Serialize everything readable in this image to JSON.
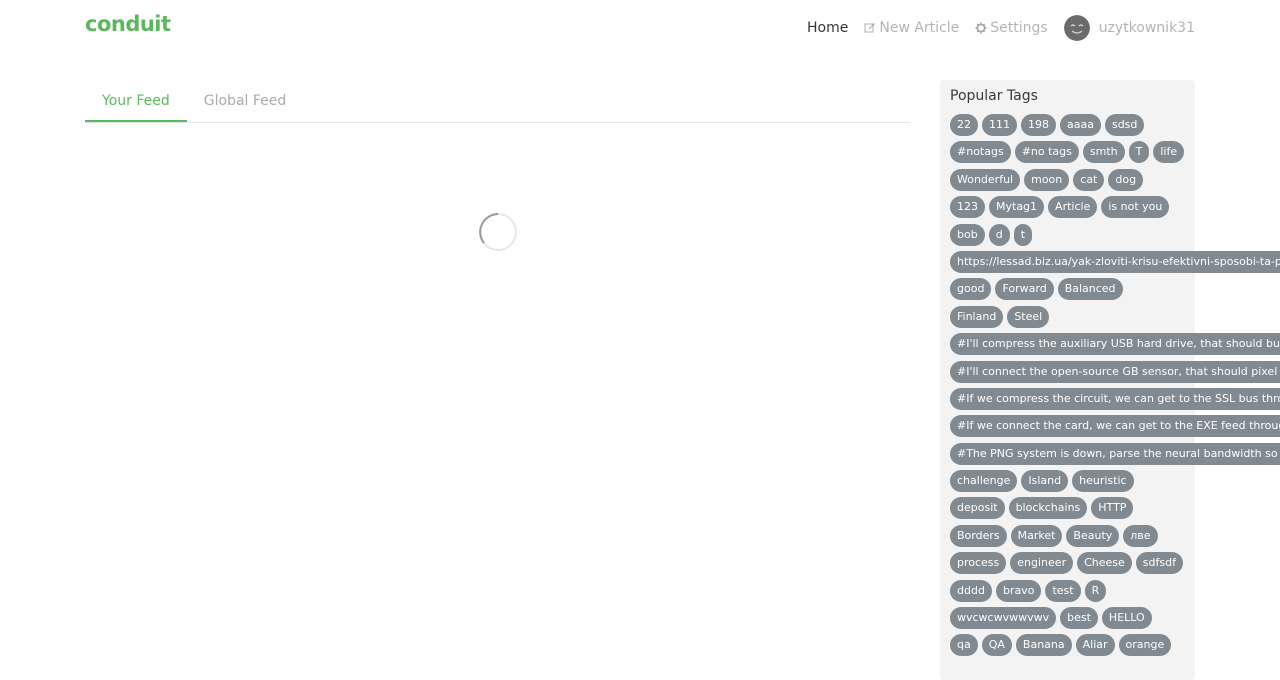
{
  "brand": "conduit",
  "nav": {
    "home": "Home",
    "new_article": "New Article",
    "settings": "Settings",
    "username": "uzytkownik31"
  },
  "feed": {
    "tabs": [
      "Your Feed",
      "Global Feed"
    ],
    "active_tab": "Your Feed"
  },
  "sidebar": {
    "title": "Popular Tags",
    "tag_rows": [
      [
        "22",
        "111",
        "198",
        "aaaa",
        "sdsd"
      ],
      [
        "#notags",
        "#no tags",
        "smth",
        "T",
        "life"
      ],
      [
        "Wonderful",
        "moon",
        "cat",
        "dog"
      ],
      [
        "123",
        "Mytag1",
        "Article",
        "is not you"
      ],
      [
        "bob",
        "d",
        "t"
      ],
      [
        "https://lessad.biz.ua/yak-zloviti-krisu-efektivni-sposobi-ta-poradi"
      ],
      [
        "good",
        "Forward",
        "Balanced"
      ],
      [
        "Finland",
        "Steel"
      ],
      [
        "#I'll compress the auxiliary USB hard drive, that should bus the"
      ],
      [
        "#I'll connect the open-source GB sensor, that should pixel the"
      ],
      [
        "#If we compress the circuit, we can get to the SSL bus through"
      ],
      [
        "#If we connect the card, we can get to the EXE feed through the"
      ],
      [
        "#The PNG system is down, parse the neural bandwidth so we"
      ],
      [
        "challenge",
        "Island",
        "heuristic"
      ],
      [
        "deposit",
        "blockchains",
        "HTTP"
      ],
      [
        "Borders",
        "Market",
        "Beauty",
        "лве"
      ],
      [
        "process",
        "engineer",
        "Cheese",
        "sdfsdf"
      ],
      [
        "dddd",
        "bravo",
        "test",
        "R"
      ],
      [
        "wvcwcwvwwvwv",
        "best",
        "HELLO"
      ],
      [
        "qa",
        "QA",
        "Banana",
        "Aliar",
        "orange"
      ]
    ]
  },
  "colors": {
    "brand": "#5cb85c",
    "tag_bg": "#818a91",
    "sidebar_bg": "#f3f3f3"
  },
  "icons": {
    "new_article": "edit-icon",
    "settings": "gear-icon",
    "avatar": "smiley-avatar-icon",
    "loading": "spinner-icon"
  }
}
